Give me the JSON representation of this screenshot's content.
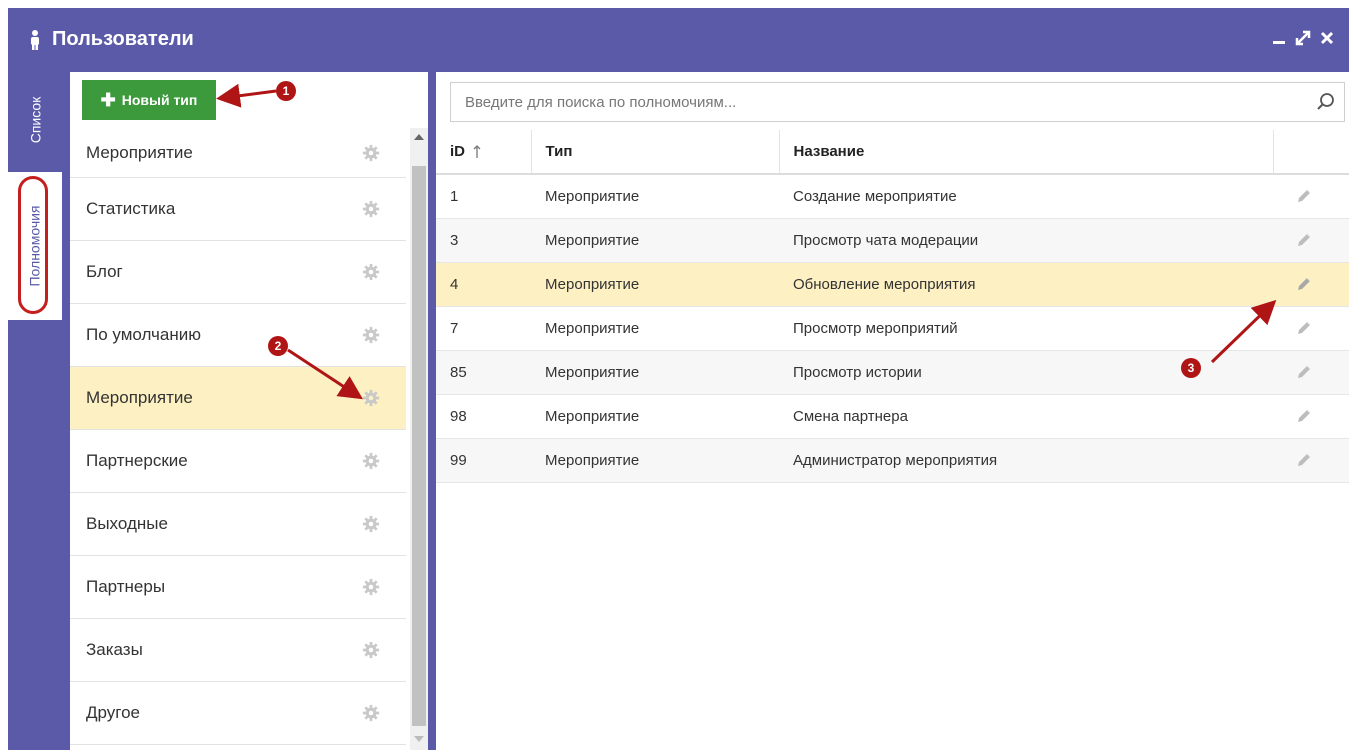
{
  "window": {
    "title": "Пользователи",
    "controls": [
      "minimize-icon",
      "expand-icon",
      "close-icon"
    ]
  },
  "vtabs": {
    "list": "Список",
    "permissions": "Полномочия"
  },
  "left": {
    "new_button": "Новый тип",
    "types": [
      {
        "label": "Мероприятие",
        "selected": false
      },
      {
        "label": "Статистика",
        "selected": false
      },
      {
        "label": "Блог",
        "selected": false
      },
      {
        "label": "По умолчанию",
        "selected": false
      },
      {
        "label": "Мероприятие",
        "selected": true
      },
      {
        "label": "Партнерские",
        "selected": false
      },
      {
        "label": "Выходные",
        "selected": false
      },
      {
        "label": "Партнеры",
        "selected": false
      },
      {
        "label": "Заказы",
        "selected": false
      },
      {
        "label": "Другое",
        "selected": false
      }
    ]
  },
  "right": {
    "search_placeholder": "Введите для поиска по полномочиям...",
    "columns": {
      "id": "iD",
      "type": "Тип",
      "name": "Название"
    },
    "rows": [
      {
        "id": "1",
        "type": "Мероприятие",
        "name": "Создание мероприятие"
      },
      {
        "id": "3",
        "type": "Мероприятие",
        "name": "Просмотр чата модерации"
      },
      {
        "id": "4",
        "type": "Мероприятие",
        "name": "Обновление мероприятия"
      },
      {
        "id": "7",
        "type": "Мероприятие",
        "name": "Просмотр мероприятий"
      },
      {
        "id": "85",
        "type": "Мероприятие",
        "name": "Просмотр истории"
      },
      {
        "id": "98",
        "type": "Мероприятие",
        "name": "Смена партнера"
      },
      {
        "id": "99",
        "type": "Мероприятие",
        "name": "Администратор мероприятия"
      }
    ],
    "selected_row_id": "4"
  },
  "annotations": {
    "marker_1": "1",
    "marker_2": "2",
    "marker_3": "3"
  },
  "colors": {
    "header": "#5b5aa8",
    "accent_green": "#3c9a3c",
    "selected_row": "#fdf0c3",
    "annotation_red": "#b01515"
  }
}
